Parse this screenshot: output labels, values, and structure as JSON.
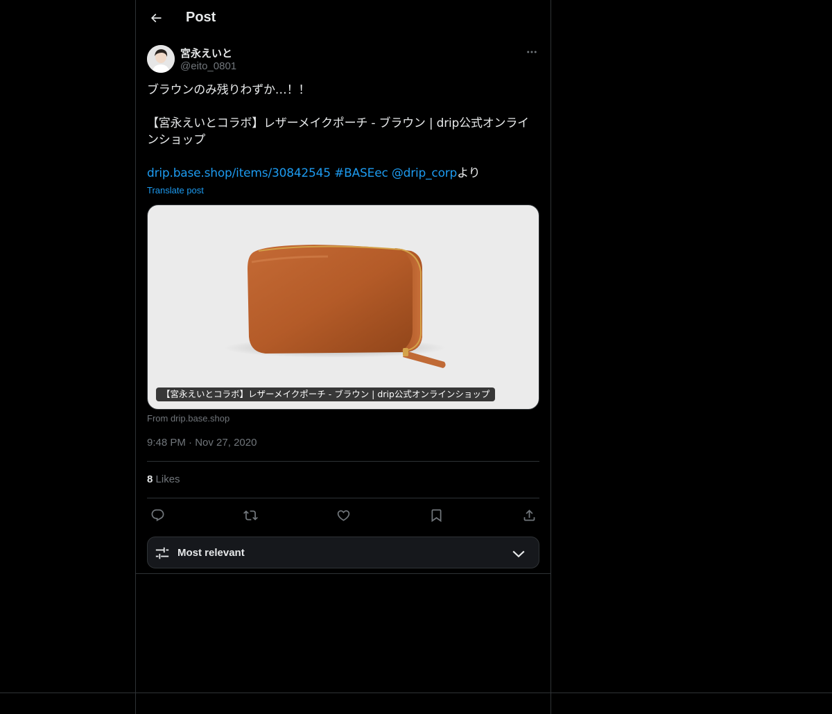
{
  "header": {
    "title": "Post",
    "back_icon": "arrow-left-icon"
  },
  "author": {
    "display_name": "宮永えいと",
    "handle": "@eito_0801",
    "more_icon": "more-horizontal-icon"
  },
  "tweet": {
    "line1": "ブラウンのみ残りわずか…！！",
    "line2": "【宮永えいとコラボ】レザーメイクポーチ - ブラウン | drip公式オンラインショップ",
    "link_url": "drip.base.shop/items/30842545",
    "hashtag": "#BASEec",
    "mention": "@drip_corp",
    "suffix": "より",
    "translate": "Translate post"
  },
  "card": {
    "caption": "【宮永えいとコラボ】レザーメイクポーチ - ブラウン | drip公式オンラインショップ",
    "source": "From drip.base.shop",
    "image": "brown-leather-pouch-photo"
  },
  "meta": {
    "time": "9:48 PM",
    "separator": "·",
    "date": "Nov 27, 2020"
  },
  "stats": {
    "likes_count": "8",
    "likes_label": "Likes"
  },
  "actions": {
    "reply_icon": "reply-icon",
    "retweet_icon": "retweet-icon",
    "like_icon": "heart-icon",
    "bookmark_icon": "bookmark-icon",
    "share_icon": "share-icon"
  },
  "sort": {
    "label": "Most relevant",
    "icon": "sliders-icon",
    "chevron": "chevron-down-icon"
  },
  "colors": {
    "background": "#000000",
    "text": "#e7e9ea",
    "muted": "#71767b",
    "accent": "#1d9bf0",
    "border": "#2f3336"
  }
}
